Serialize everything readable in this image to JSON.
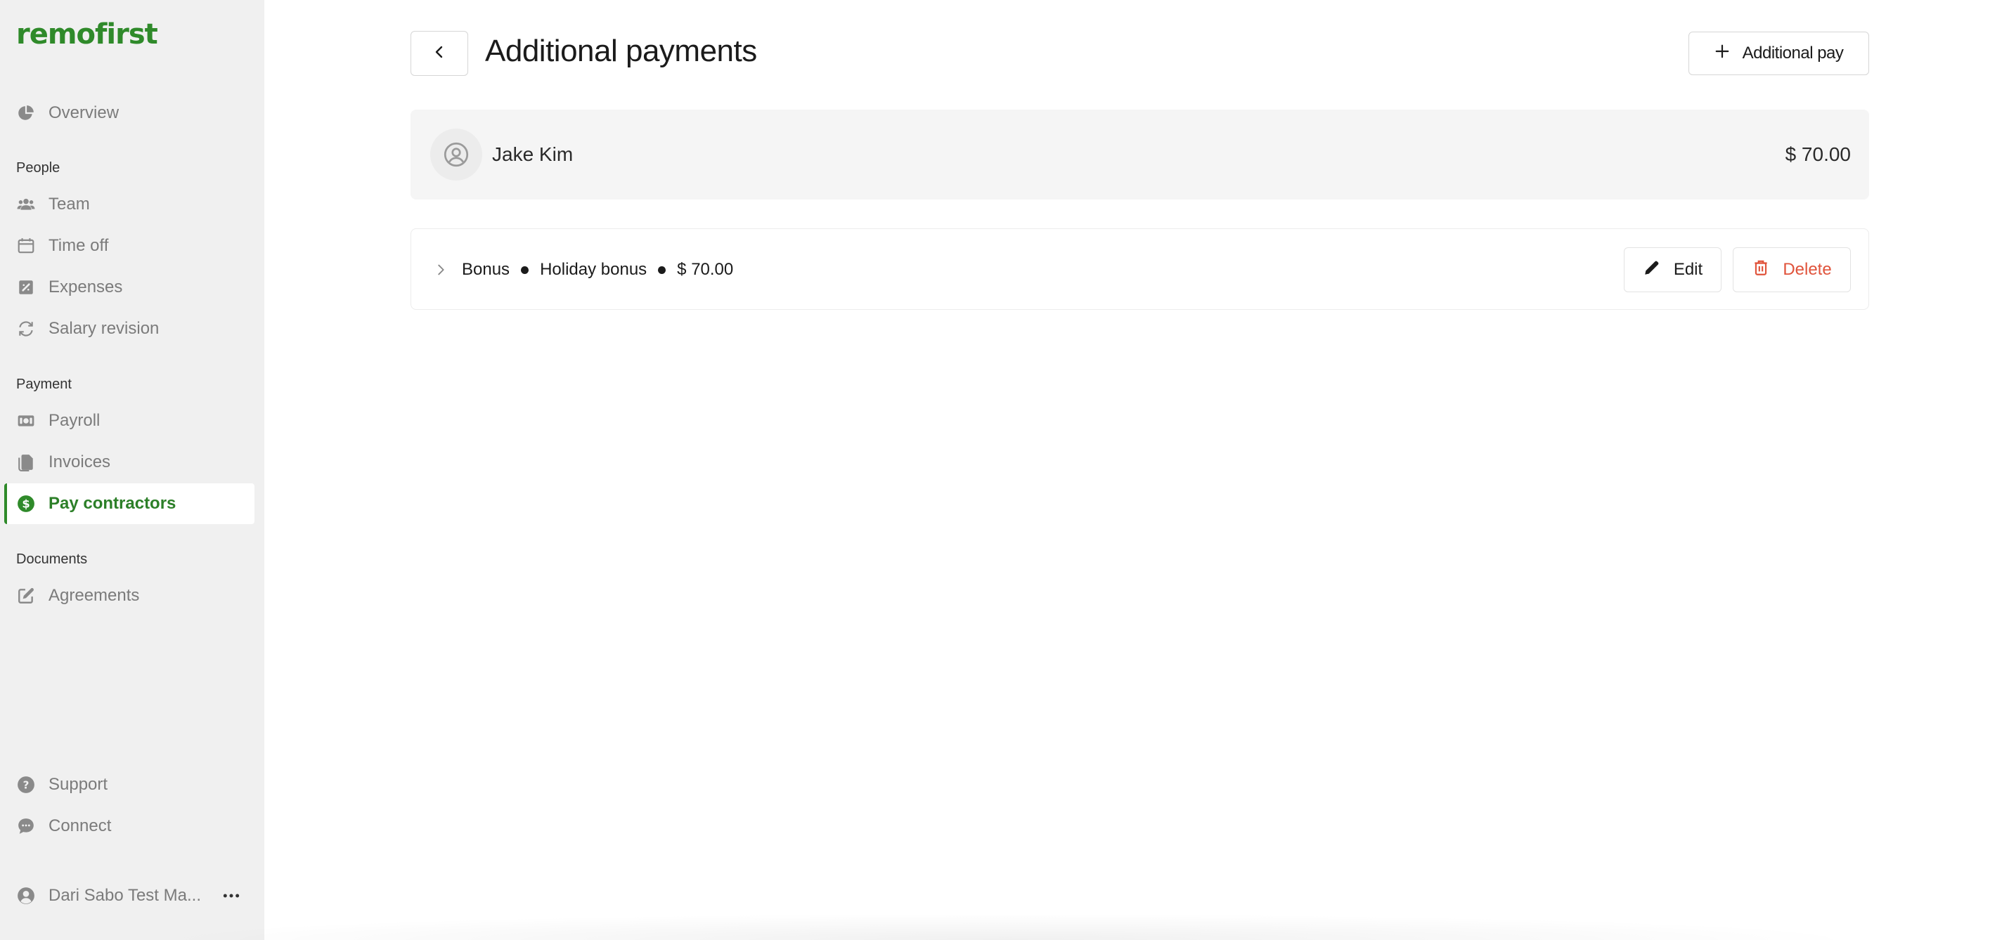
{
  "app": {
    "logo_text": "remofirst",
    "brand_color": "#2f8a2a",
    "danger_color": "#e0533b"
  },
  "sidebar": {
    "top_item": {
      "label": "Overview",
      "icon": "pie-chart-icon"
    },
    "sections": [
      {
        "label": "People",
        "items": [
          {
            "label": "Team",
            "icon": "users-icon"
          },
          {
            "label": "Time off",
            "icon": "calendar-icon"
          },
          {
            "label": "Expenses",
            "icon": "receipt-icon"
          },
          {
            "label": "Salary revision",
            "icon": "refresh-icon"
          }
        ]
      },
      {
        "label": "Payment",
        "items": [
          {
            "label": "Payroll",
            "icon": "money-icon"
          },
          {
            "label": "Invoices",
            "icon": "files-icon"
          },
          {
            "label": "Pay contractors",
            "icon": "dollar-circle-icon",
            "active": true
          }
        ]
      },
      {
        "label": "Documents",
        "items": [
          {
            "label": "Agreements",
            "icon": "edit-document-icon"
          }
        ]
      }
    ],
    "bottom_items": [
      {
        "label": "Support",
        "icon": "help-circle-icon"
      },
      {
        "label": "Connect",
        "icon": "chat-icon"
      }
    ],
    "user": {
      "name": "Dari Sabo Test Ma...",
      "icon": "user-circle-icon",
      "menu_icon": "more-horizontal-icon"
    }
  },
  "main": {
    "title": "Additional payments",
    "add_button_label": "Additional pay",
    "person": {
      "name": "Jake Kim",
      "total": "$ 70.00"
    },
    "payment": {
      "type": "Bonus",
      "name": "Holiday bonus",
      "amount": "$ 70.00",
      "edit_label": "Edit",
      "delete_label": "Delete"
    }
  }
}
